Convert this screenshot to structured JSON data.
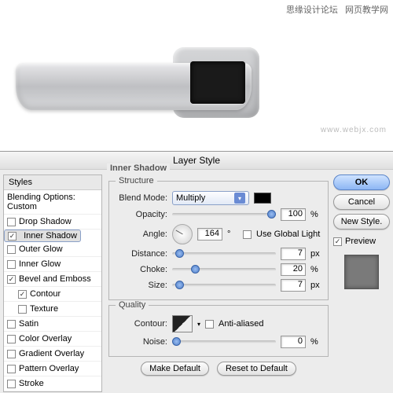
{
  "header": {
    "left": "思缘设计论坛",
    "right": "网页教学网"
  },
  "watermark": "www.webjx.com",
  "dialog": {
    "title": "Layer Style",
    "styles_header": "Styles",
    "blending_row": "Blending Options: Custom",
    "panel_title": "Inner Shadow",
    "items": [
      {
        "label": "Drop Shadow",
        "checked": false,
        "selected": false
      },
      {
        "label": "Inner Shadow",
        "checked": true,
        "selected": true
      },
      {
        "label": "Outer Glow",
        "checked": false,
        "selected": false
      },
      {
        "label": "Inner Glow",
        "checked": false,
        "selected": false
      },
      {
        "label": "Bevel and Emboss",
        "checked": true,
        "selected": false
      },
      {
        "label": "Contour",
        "checked": true,
        "selected": false,
        "indent": true
      },
      {
        "label": "Texture",
        "checked": false,
        "selected": false,
        "indent": true
      },
      {
        "label": "Satin",
        "checked": false,
        "selected": false
      },
      {
        "label": "Color Overlay",
        "checked": false,
        "selected": false
      },
      {
        "label": "Gradient Overlay",
        "checked": false,
        "selected": false
      },
      {
        "label": "Pattern Overlay",
        "checked": false,
        "selected": false
      },
      {
        "label": "Stroke",
        "checked": false,
        "selected": false
      }
    ],
    "structure": {
      "group_label": "Structure",
      "blend_mode": {
        "label": "Blend Mode:",
        "value": "Multiply"
      },
      "opacity": {
        "label": "Opacity:",
        "value": "100",
        "unit": "%"
      },
      "angle": {
        "label": "Angle:",
        "value": "164",
        "unit": "°",
        "global": "Use Global Light",
        "global_checked": false
      },
      "distance": {
        "label": "Distance:",
        "value": "7",
        "unit": "px"
      },
      "choke": {
        "label": "Choke:",
        "value": "20",
        "unit": "%"
      },
      "size": {
        "label": "Size:",
        "value": "7",
        "unit": "px"
      }
    },
    "quality": {
      "group_label": "Quality",
      "contour": {
        "label": "Contour:",
        "anti": "Anti-aliased",
        "anti_checked": false
      },
      "noise": {
        "label": "Noise:",
        "value": "0",
        "unit": "%"
      }
    },
    "defaults": {
      "make": "Make Default",
      "reset": "Reset to Default"
    },
    "right": {
      "ok": "OK",
      "cancel": "Cancel",
      "newstyle": "New Style.",
      "preview": "Preview",
      "preview_checked": true
    }
  }
}
